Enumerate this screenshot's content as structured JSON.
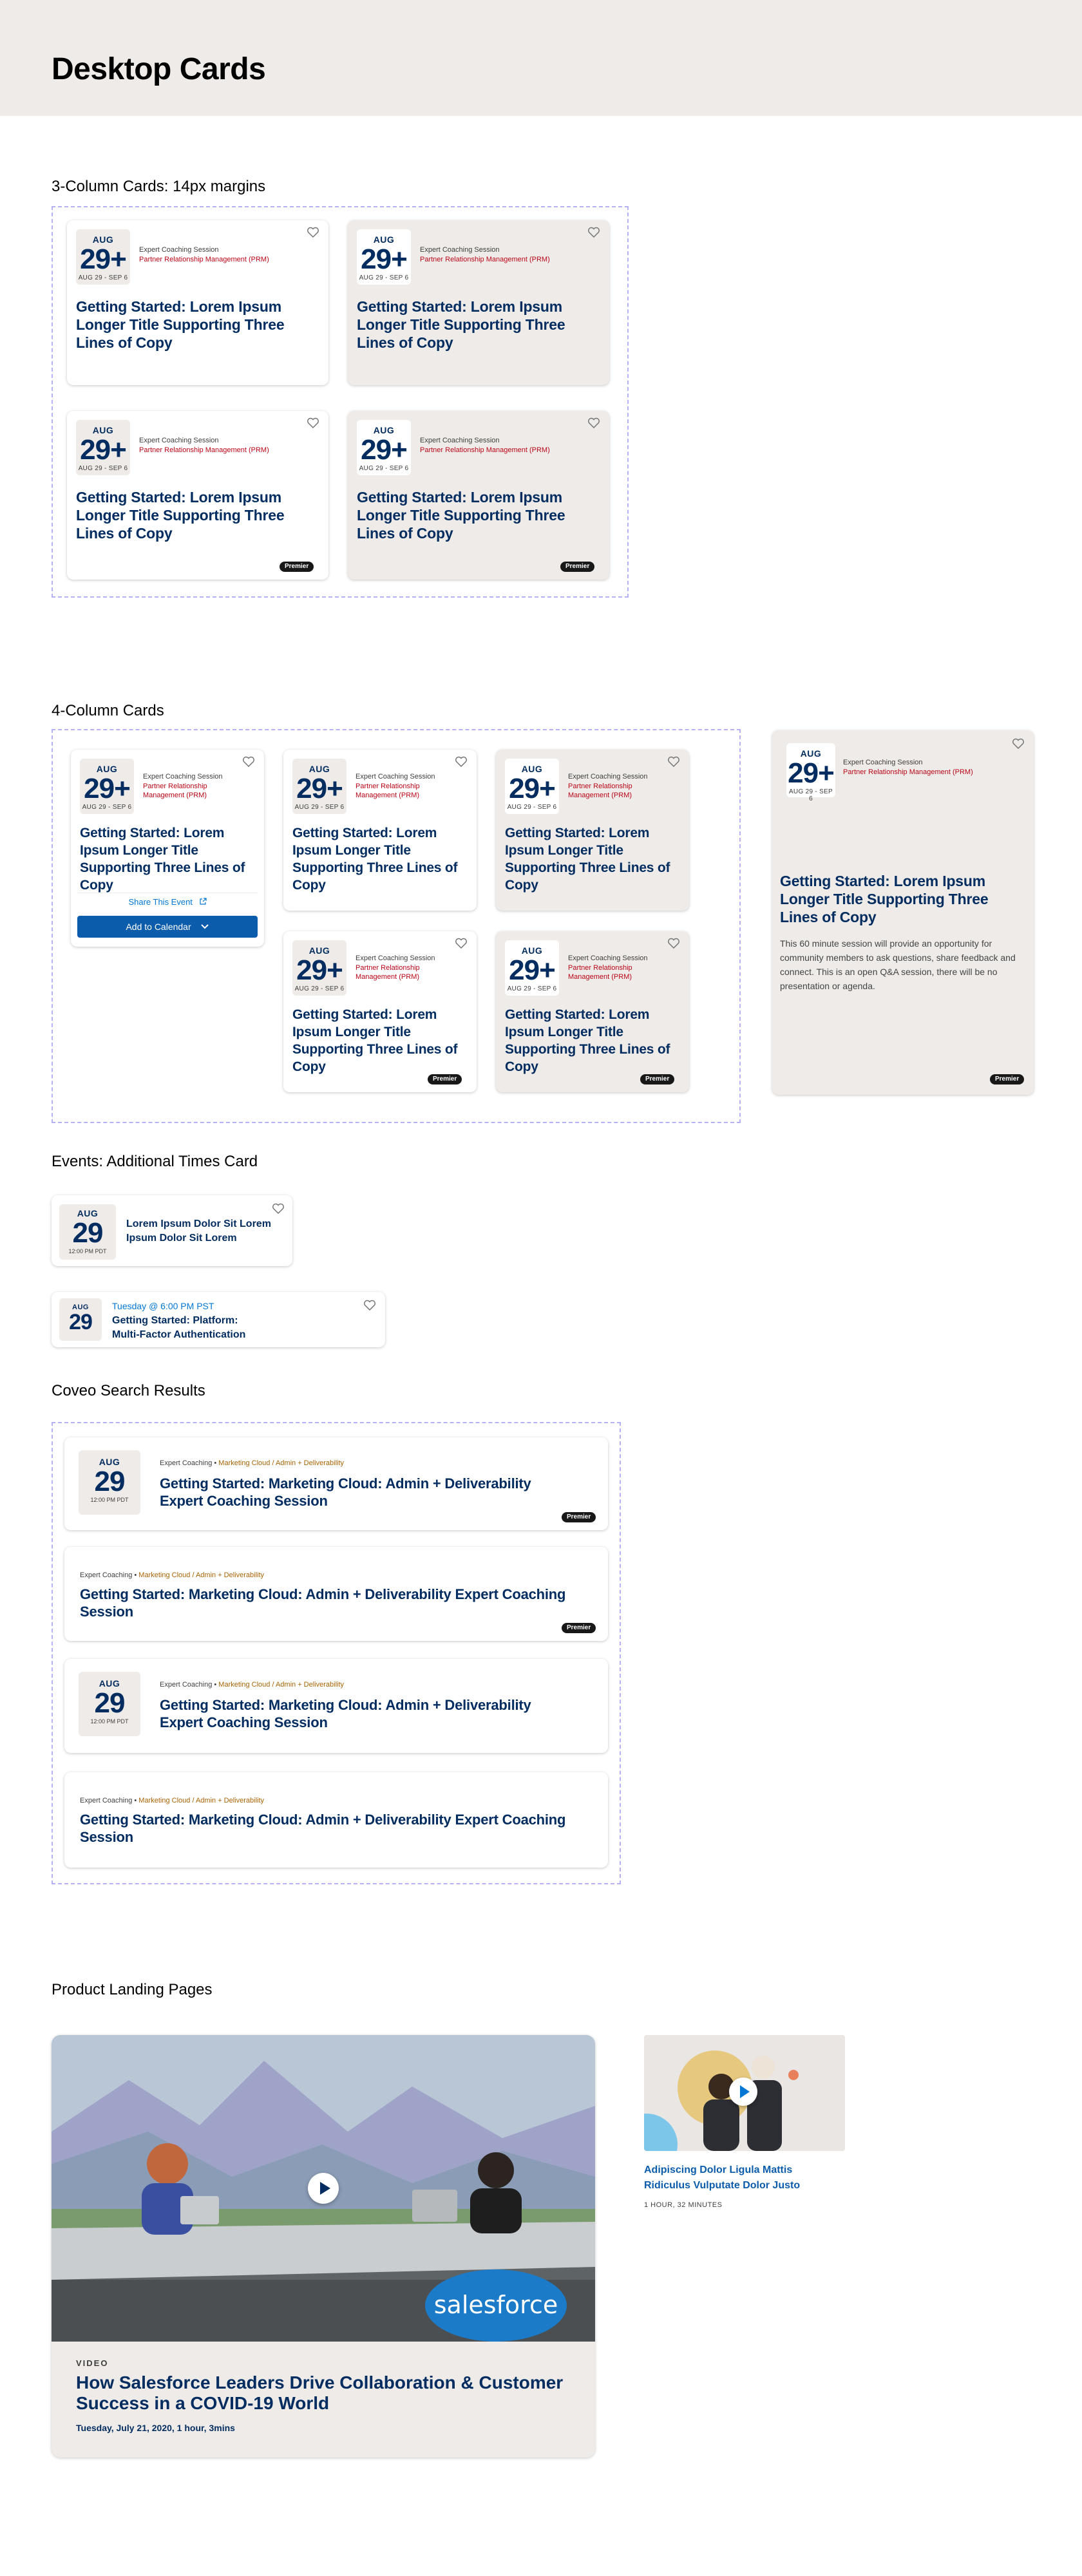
{
  "page": {
    "title": "Desktop Cards"
  },
  "sections": {
    "three_col": "3-Column Cards: 14px margins",
    "four_col": "4-Column Cards",
    "events": "Events: Additional Times Card",
    "coveo": "Coveo Search Results",
    "landing": "Product Landing Pages"
  },
  "event_card": {
    "month": "AUG",
    "day": "29+",
    "range": "AUG 29 - SEP 6",
    "session_type": "Expert Coaching Session",
    "program": "Partner Relationship Management (PRM)",
    "title": "Getting Started: Lorem Ipsum Longer Title Supporting Three Lines of Copy",
    "badge": "Premier",
    "share": "Share This Event",
    "calendar": "Add to Calendar",
    "description": "This 60 minute session will provide an opportunity for community members to ask questions, share feedback and connect. This is an open Q&A session, there will be no presentation or agenda."
  },
  "additional_times": {
    "card1": {
      "month": "AUG",
      "day": "29",
      "time": "12:00 PM PDT",
      "title": "Lorem Ipsum Dolor Sit Lorem Ipsum Dolor Sit Lorem"
    },
    "card2": {
      "month": "AUG",
      "day": "29",
      "when": "Tuesday @ 6:00 PM PST",
      "title": "Getting Started: Platform: Multi-Factor Authentication"
    }
  },
  "coveo": {
    "month": "AUG",
    "day": "29",
    "time": "12:00 PM PDT",
    "type": "Expert Coaching",
    "path": "Marketing Cloud / Admin + Deliverability",
    "title": "Getting Started: Marketing Cloud: Admin + Deliverability Expert Coaching Session",
    "badge": "Premier"
  },
  "landing": {
    "video": {
      "kicker": "VIDEO",
      "title": "How Salesforce Leaders Drive Collaboration & Customer Success in a COVID-19 World",
      "meta": "Tuesday, July 21, 2020, 1 hour, 3mins",
      "logo": "salesforce"
    },
    "small": {
      "title": "Adipiscing Dolor Ligula Mattis Ridiculus Vulputate Dolor Justo",
      "duration": "1 HOUR, 32 MINUTES"
    }
  },
  "colors": {
    "navy": "#032d60",
    "beige": "#eeebe8",
    "red": "#ba0517",
    "blue": "#0b5cab",
    "dashed": "#b4b1f5"
  },
  "icons": [
    "heart-icon",
    "external-link-icon",
    "chevron-down-icon",
    "play-icon"
  ]
}
